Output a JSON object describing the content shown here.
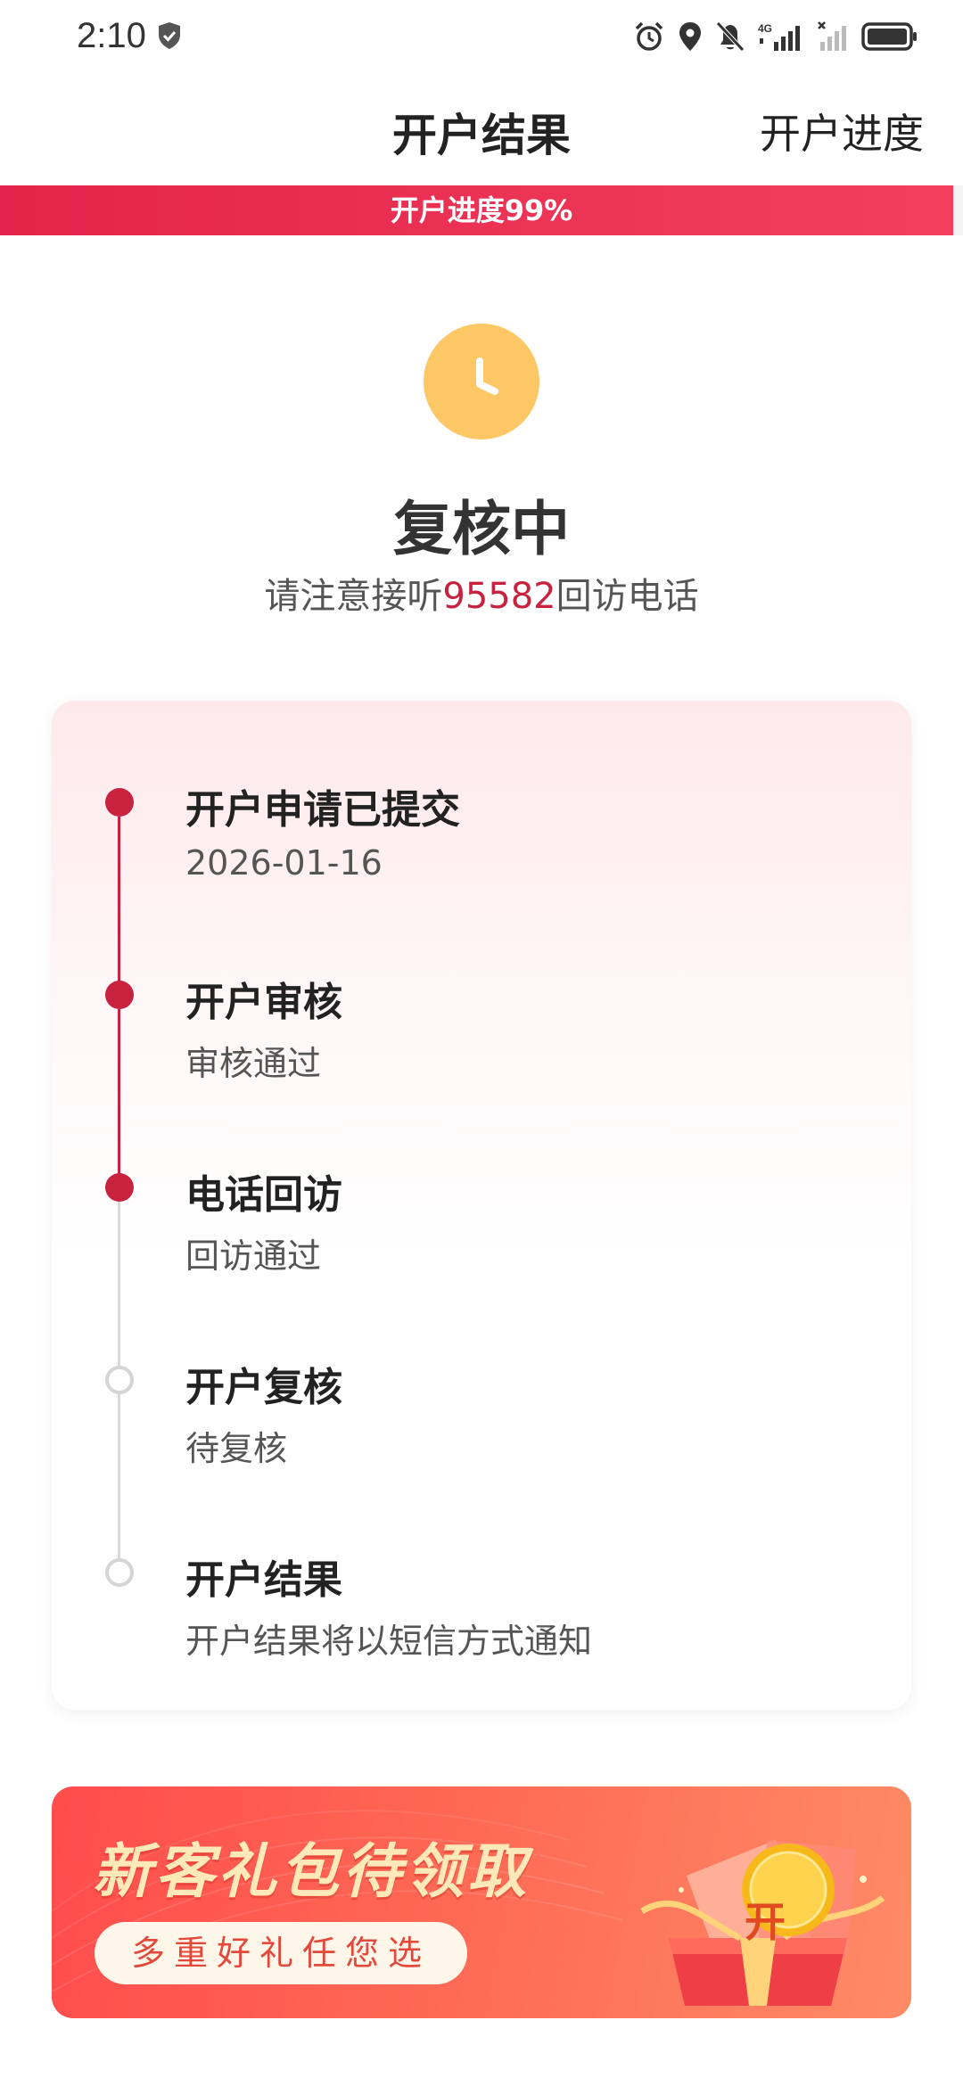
{
  "status_bar": {
    "time": "2:10",
    "network": "4G"
  },
  "header": {
    "title": "开户结果",
    "progress_link": "开户进度"
  },
  "progress": {
    "text": "开户进度99%",
    "percent": 99
  },
  "status": {
    "icon": "clock-icon",
    "title": "复核中",
    "subtitle_prefix": "请注意接听",
    "phone": "95582",
    "subtitle_suffix": "回访电话"
  },
  "colors": {
    "accent": "#c8223e",
    "clock": "#fdc765",
    "pending": "#d5d5d5"
  },
  "timeline": [
    {
      "title": "开户申请已提交",
      "desc": "2026-01-16",
      "state": "done"
    },
    {
      "title": "开户审核",
      "desc": "审核通过",
      "state": "done"
    },
    {
      "title": "电话回访",
      "desc": "回访通过",
      "state": "done"
    },
    {
      "title": "开户复核",
      "desc": "待复核",
      "state": "pending"
    },
    {
      "title": "开户结果",
      "desc": "开户结果将以短信方式通知",
      "state": "pending"
    }
  ],
  "promo": {
    "title": "新客礼包待领取",
    "subtitle": "多重好礼任您选",
    "coin_label": "开"
  }
}
